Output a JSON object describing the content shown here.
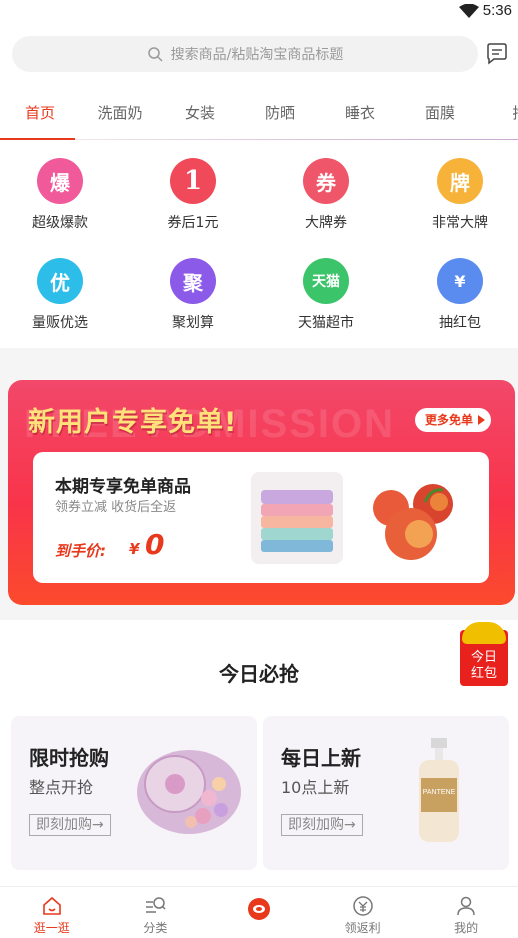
{
  "status": {
    "time": "5:36"
  },
  "search": {
    "placeholder": "搜索商品/粘贴淘宝商品标题"
  },
  "tabs": [
    "首页",
    "洗面奶",
    "女装",
    "防晒",
    "睡衣",
    "面膜",
    "拖"
  ],
  "grid": [
    {
      "icon_text": "爆",
      "label": "超级爆款",
      "color": "#f05a9a"
    },
    {
      "icon_text": "1",
      "label": "券后1元",
      "color": "#f04a5a"
    },
    {
      "icon_text": "券",
      "label": "大牌券",
      "color": "#f0566a"
    },
    {
      "icon_text": "牌",
      "label": "非常大牌",
      "color": "#f7b23a"
    },
    {
      "icon_text": "优",
      "label": "量贩优选",
      "color": "#2cbde8"
    },
    {
      "icon_text": "聚",
      "label": "聚划算",
      "color": "#8c5ae8"
    },
    {
      "icon_text": "天猫",
      "label": "天猫超市",
      "color": "#3cc46a"
    },
    {
      "icon_text": "¥",
      "label": "抽红包",
      "color": "#5a8cf0"
    }
  ],
  "banner": {
    "title": "新用户专享免单!",
    "watermark": "FREE ADMISSION",
    "more": "更多免单",
    "card_title": "本期专享免单商品",
    "card_sub": "领券立减 收货后全返",
    "price_label": "到手价:",
    "price_currency": "¥",
    "price_value": "0"
  },
  "redpacket": {
    "line1": "今日",
    "line2": "红包"
  },
  "section_title": "今日必抢",
  "deals": [
    {
      "title": "限时抢购",
      "sub": "整点开抢",
      "button": "即刻加购→"
    },
    {
      "title": "每日上新",
      "sub": "10点上新",
      "button": "即刻加购→",
      "product_text": "PANTENE"
    }
  ],
  "bottom_nav": [
    {
      "label": "逛一逛",
      "icon": "home-icon"
    },
    {
      "label": "分类",
      "icon": "category-search-icon"
    },
    {
      "label": "",
      "icon": "center-logo-icon"
    },
    {
      "label": "领返利",
      "icon": "rebate-icon"
    },
    {
      "label": "我的",
      "icon": "profile-icon"
    }
  ],
  "colors": {
    "accent": "#e8391c",
    "banner_title": "#ffe27a"
  }
}
